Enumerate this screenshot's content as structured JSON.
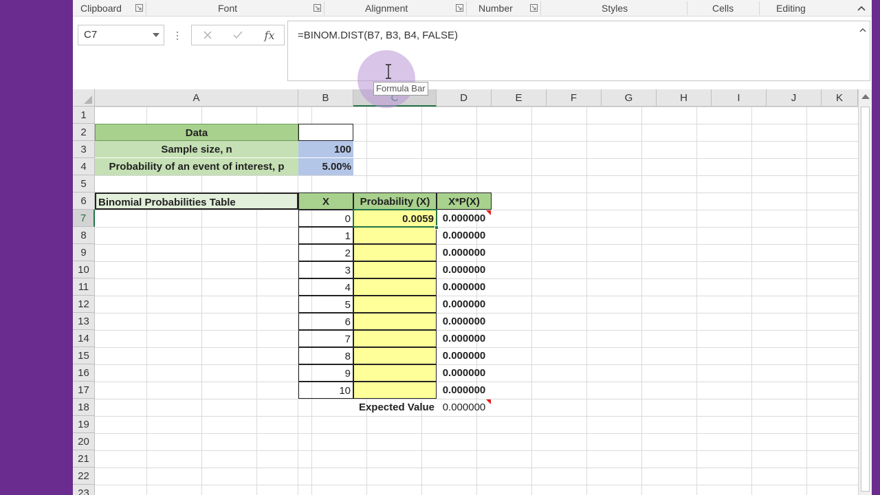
{
  "ribbon": {
    "groups": [
      "Clipboard",
      "Font",
      "Alignment",
      "Number",
      "Styles",
      "Cells",
      "Editing"
    ]
  },
  "formula_bar": {
    "name_box": "C7",
    "formula": "=BINOM.DIST(B7, B3, B4, FALSE)",
    "fx_label": "fx",
    "tooltip": "Formula Bar"
  },
  "columns": [
    "A",
    "B",
    "C",
    "D",
    "E",
    "F",
    "G",
    "H",
    "I",
    "J",
    "K"
  ],
  "rows": [
    "1",
    "2",
    "3",
    "4",
    "5",
    "6",
    "7",
    "8",
    "9",
    "10",
    "11",
    "12",
    "13",
    "14",
    "15",
    "16",
    "17",
    "18",
    "19",
    "20",
    "21",
    "22",
    "23"
  ],
  "sheet": {
    "data_title": "Data",
    "sample_size_label": "Sample size, n",
    "sample_size_value": "100",
    "prob_label": "Probability of an event of interest, p",
    "prob_value": "5.00%",
    "table_title": "Binomial Probabilities Table",
    "col_x": "X",
    "col_prob": "Probability (X)",
    "col_xpx": "X*P(X)",
    "x_values": [
      "0",
      "1",
      "2",
      "3",
      "4",
      "5",
      "6",
      "7",
      "8",
      "9",
      "10"
    ],
    "prob_values": [
      "0.0059",
      "",
      "",
      "",
      "",
      "",
      "",
      "",
      "",
      "",
      ""
    ],
    "xpx_values": [
      "0.000000",
      "0.000000",
      "0.000000",
      "0.000000",
      "0.000000",
      "0.000000",
      "0.000000",
      "0.000000",
      "0.000000",
      "0.000000",
      "0.000000"
    ],
    "expected_label": "Expected Value",
    "expected_value": "0.000000"
  },
  "colors": {
    "green_header": "#a9d18e",
    "green_light": "#c5e0b4",
    "blue_input": "#b4c6e7",
    "yellow_fill": "#ffff99",
    "table_header_fill": "#e2efda",
    "purple_frame": "#6a2c8e",
    "selection_green": "#217346"
  },
  "icons": [
    "dialog-launcher-icon",
    "collapse-ribbon-icon",
    "dropdown-arrow-icon",
    "cancel-icon",
    "enter-icon",
    "insert-function-icon",
    "expand-formula-icon",
    "ibeam-cursor-icon"
  ]
}
